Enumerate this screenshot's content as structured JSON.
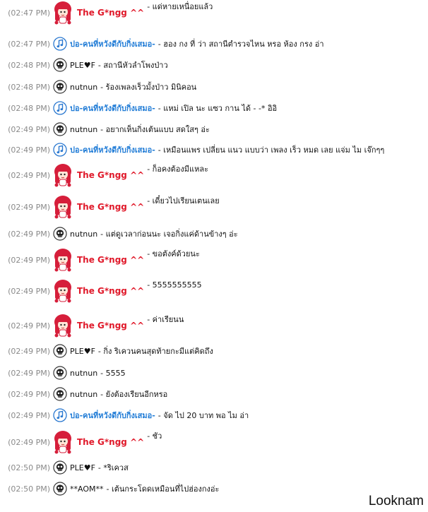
{
  "messages": [
    {
      "time": "(02:47 PM)",
      "avatar": "redhead-girl",
      "sender": "The G*ngg ^^",
      "color": "red",
      "text": "- แด่หายเหนื่อยแล้ว"
    },
    {
      "time": "(02:47 PM)",
      "avatar": "music-note",
      "sender": "ปอ-คนที่หวังดีกับกิ่งเสมอ-",
      "color": "blue",
      "text": "- ฮอง กง ที่ ว่า สถานีตำรวจไหน หรอ ห้อง กรง อ่า"
    },
    {
      "time": "(02:48 PM)",
      "avatar": "skull",
      "sender": "PLE♥F",
      "color": "dark",
      "text": "- สถานีหัวลำโพงป่าว"
    },
    {
      "time": "(02:48 PM)",
      "avatar": "skull",
      "sender": "nutnun",
      "color": "dark",
      "text": "- ร้องเพลงเร็วมั้งป่าว มินิคอน"
    },
    {
      "time": "(02:48 PM)",
      "avatar": "music-note",
      "sender": "ปอ-คนที่หวังดีกับกิ่งเสมอ-",
      "color": "blue",
      "text": "- แหม่ เปิล นะ แซว กาน ได้ - -* อิอิ"
    },
    {
      "time": "(02:49 PM)",
      "avatar": "skull",
      "sender": "nutnun",
      "color": "dark",
      "text": "- อยากเห็นกิ่งเต้นแบบ สดใสๆ อ่ะ"
    },
    {
      "time": "(02:49 PM)",
      "avatar": "music-note",
      "sender": "ปอ-คนที่หวังดีกับกิ่งเสมอ-",
      "color": "blue",
      "text": "- เหมือนแพร เปลี่ยน แนว แบบว่า เพลง เร็ว หมด เลย แจ่ม ไม เจ๊กๆๆ"
    },
    {
      "time": "(02:49 PM)",
      "avatar": "redhead-girl",
      "sender": "The G*ngg ^^",
      "color": "red",
      "text": "- ก็อคงต้องมีแหละ"
    },
    {
      "time": "(02:49 PM)",
      "avatar": "redhead-girl",
      "sender": "The G*ngg ^^",
      "color": "red",
      "text": "- เดี๋ยวไปเรียนเตนเลย"
    },
    {
      "time": "(02:49 PM)",
      "avatar": "skull",
      "sender": "nutnun",
      "color": "dark",
      "text": "- แต่ดูเวลาก่อนนะ เจอกิ่งแค่ด้านข้างๆ อ่ะ"
    },
    {
      "time": "(02:49 PM)",
      "avatar": "redhead-girl",
      "sender": "The G*ngg ^^",
      "color": "red",
      "text": "- ขอตังค์ด้วยนะ"
    },
    {
      "time": "(02:49 PM)",
      "avatar": "redhead-girl",
      "sender": "The G*ngg ^^",
      "color": "red",
      "text": "- 5555555555"
    },
    {
      "time": "(02:49 PM)",
      "avatar": "redhead-girl",
      "sender": "The G*ngg ^^",
      "color": "red",
      "text": "- ค่าเรียนน"
    },
    {
      "time": "(02:49 PM)",
      "avatar": "skull",
      "sender": "PLE♥F",
      "color": "dark",
      "text": "- กิ่ง ริเควนคนสุดท้ายกะมีแต่คิดถึง"
    },
    {
      "time": "(02:49 PM)",
      "avatar": "skull",
      "sender": "nutnun",
      "color": "dark",
      "text": "- 5555"
    },
    {
      "time": "(02:49 PM)",
      "avatar": "skull",
      "sender": "nutnun",
      "color": "dark",
      "text": "- ยังต้องเรียนอีกหรอ"
    },
    {
      "time": "(02:49 PM)",
      "avatar": "music-note",
      "sender": "ปอ-คนที่หวังดีกับกิ่งเสมอ-",
      "color": "blue",
      "text": "- จัด ไป 20 บาท พอ ไม อ่า"
    },
    {
      "time": "(02:49 PM)",
      "avatar": "redhead-girl",
      "sender": "The G*ngg ^^",
      "color": "red",
      "text": "- ชัว"
    },
    {
      "time": "(02:50 PM)",
      "avatar": "skull",
      "sender": "PLE♥F",
      "color": "dark",
      "text": "- *ริเควส"
    },
    {
      "time": "(02:50 PM)",
      "avatar": "skull",
      "sender": "**AOM**",
      "color": "dark",
      "text": "- เต้นกระโดดเหมือนที่ไปฮ่องกงอ่ะ"
    }
  ],
  "watermark": "Looknam"
}
